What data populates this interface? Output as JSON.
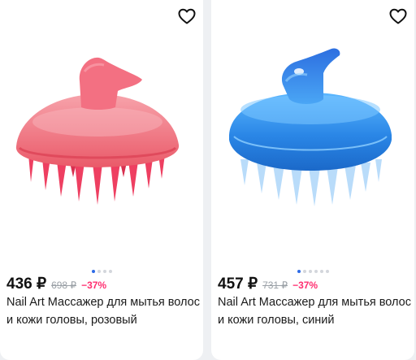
{
  "products": [
    {
      "price": "436 ₽",
      "old_price": "698 ₽",
      "discount": "−37%",
      "title": "Nail Art Массажер для мытья волос и кожи головы, розовый",
      "color": "#f06a79",
      "image_dots": 4,
      "active_dot": 0,
      "favorite_icon": "heart-outline-icon"
    },
    {
      "price": "457 ₽",
      "old_price": "731 ₽",
      "discount": "−37%",
      "title": "Nail Art Массажер для мытья волос и кожи головы, синий",
      "color": "#2f8ee8",
      "image_dots": 6,
      "active_dot": 0,
      "favorite_icon": "heart-outline-icon"
    }
  ]
}
